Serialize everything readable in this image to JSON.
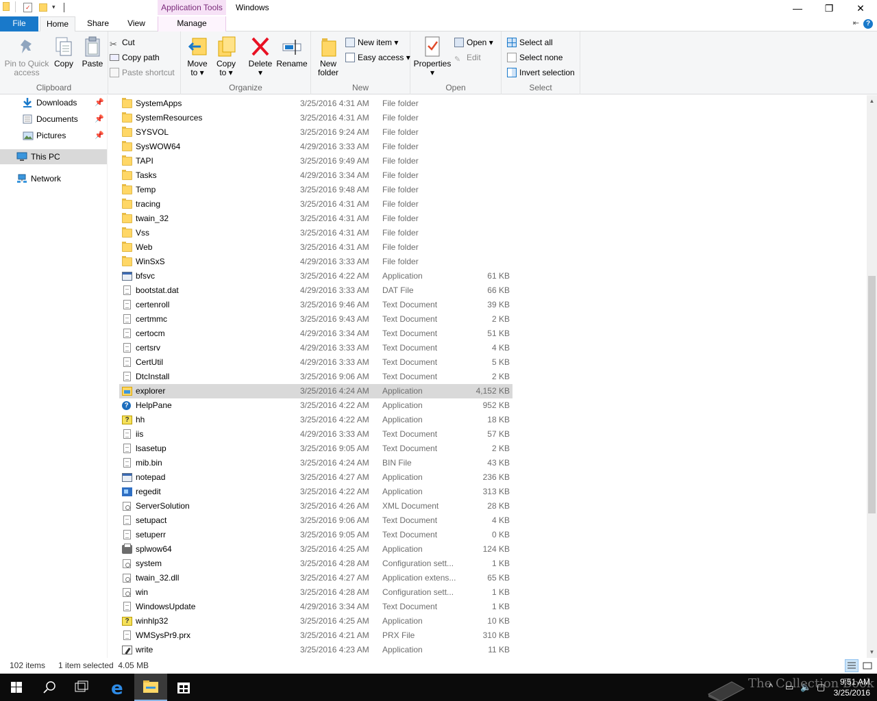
{
  "window": {
    "context_tab": "Application Tools",
    "title": "Windows",
    "minimize": "—",
    "maximize": "❐",
    "close": "✕"
  },
  "tabs": {
    "file": "File",
    "home": "Home",
    "share": "Share",
    "view": "View",
    "manage": "Manage",
    "help": "?"
  },
  "ribbon": {
    "clipboard": {
      "label": "Clipboard",
      "pin_line1": "Pin to Quick",
      "pin_line2": "access",
      "copy": "Copy",
      "paste": "Paste",
      "cut": "Cut",
      "copy_path": "Copy path",
      "paste_shortcut": "Paste shortcut"
    },
    "organize": {
      "label": "Organize",
      "move_line1": "Move",
      "move_line2": "to ▾",
      "copy_line1": "Copy",
      "copy_line2": "to ▾",
      "delete_line1": "Delete",
      "delete_line2": "▾",
      "rename": "Rename"
    },
    "new": {
      "label": "New",
      "new_folder_line1": "New",
      "new_folder_line2": "folder",
      "new_item": "New item ▾",
      "easy_access": "Easy access ▾"
    },
    "open": {
      "label": "Open",
      "properties_line1": "Properties",
      "properties_line2": "▾",
      "open": "Open ▾",
      "edit": "Edit"
    },
    "select": {
      "label": "Select",
      "select_all": "Select all",
      "select_none": "Select none",
      "invert_selection": "Invert selection"
    }
  },
  "nav": {
    "downloads": "Downloads",
    "documents": "Documents",
    "pictures": "Pictures",
    "this_pc": "This PC",
    "network": "Network",
    "pin": "📌"
  },
  "files": [
    {
      "name": "SystemApps",
      "date": "3/25/2016 4:31 AM",
      "type": "File folder",
      "size": "",
      "icon": "folder"
    },
    {
      "name": "SystemResources",
      "date": "3/25/2016 4:31 AM",
      "type": "File folder",
      "size": "",
      "icon": "folder"
    },
    {
      "name": "SYSVOL",
      "date": "3/25/2016 9:24 AM",
      "type": "File folder",
      "size": "",
      "icon": "folder"
    },
    {
      "name": "SysWOW64",
      "date": "4/29/2016 3:33 AM",
      "type": "File folder",
      "size": "",
      "icon": "folder"
    },
    {
      "name": "TAPI",
      "date": "3/25/2016 9:49 AM",
      "type": "File folder",
      "size": "",
      "icon": "folder"
    },
    {
      "name": "Tasks",
      "date": "4/29/2016 3:34 AM",
      "type": "File folder",
      "size": "",
      "icon": "folder"
    },
    {
      "name": "Temp",
      "date": "3/25/2016 9:48 AM",
      "type": "File folder",
      "size": "",
      "icon": "folder"
    },
    {
      "name": "tracing",
      "date": "3/25/2016 4:31 AM",
      "type": "File folder",
      "size": "",
      "icon": "folder"
    },
    {
      "name": "twain_32",
      "date": "3/25/2016 4:31 AM",
      "type": "File folder",
      "size": "",
      "icon": "folder"
    },
    {
      "name": "Vss",
      "date": "3/25/2016 4:31 AM",
      "type": "File folder",
      "size": "",
      "icon": "folder"
    },
    {
      "name": "Web",
      "date": "3/25/2016 4:31 AM",
      "type": "File folder",
      "size": "",
      "icon": "folder"
    },
    {
      "name": "WinSxS",
      "date": "4/29/2016 3:33 AM",
      "type": "File folder",
      "size": "",
      "icon": "folder"
    },
    {
      "name": "bfsvc",
      "date": "3/25/2016 4:22 AM",
      "type": "Application",
      "size": "61 KB",
      "icon": "app"
    },
    {
      "name": "bootstat.dat",
      "date": "4/29/2016 3:33 AM",
      "type": "DAT File",
      "size": "66 KB",
      "icon": "doc"
    },
    {
      "name": "certenroll",
      "date": "3/25/2016 9:46 AM",
      "type": "Text Document",
      "size": "39 KB",
      "icon": "doc"
    },
    {
      "name": "certmmc",
      "date": "3/25/2016 9:43 AM",
      "type": "Text Document",
      "size": "2 KB",
      "icon": "doc"
    },
    {
      "name": "certocm",
      "date": "4/29/2016 3:34 AM",
      "type": "Text Document",
      "size": "51 KB",
      "icon": "doc"
    },
    {
      "name": "certsrv",
      "date": "4/29/2016 3:33 AM",
      "type": "Text Document",
      "size": "4 KB",
      "icon": "doc"
    },
    {
      "name": "CertUtil",
      "date": "4/29/2016 3:33 AM",
      "type": "Text Document",
      "size": "5 KB",
      "icon": "doc"
    },
    {
      "name": "DtcInstall",
      "date": "3/25/2016 9:06 AM",
      "type": "Text Document",
      "size": "2 KB",
      "icon": "doc"
    },
    {
      "name": "explorer",
      "date": "3/25/2016 4:24 AM",
      "type": "Application",
      "size": "4,152 KB",
      "icon": "explorer",
      "selected": true
    },
    {
      "name": "HelpPane",
      "date": "3/25/2016 4:22 AM",
      "type": "Application",
      "size": "952 KB",
      "icon": "help"
    },
    {
      "name": "hh",
      "date": "3/25/2016 4:22 AM",
      "type": "Application",
      "size": "18 KB",
      "icon": "ques"
    },
    {
      "name": "iis",
      "date": "4/29/2016 3:33 AM",
      "type": "Text Document",
      "size": "57 KB",
      "icon": "doc"
    },
    {
      "name": "lsasetup",
      "date": "3/25/2016 9:05 AM",
      "type": "Text Document",
      "size": "2 KB",
      "icon": "doc"
    },
    {
      "name": "mib.bin",
      "date": "3/25/2016 4:24 AM",
      "type": "BIN File",
      "size": "43 KB",
      "icon": "doc"
    },
    {
      "name": "notepad",
      "date": "3/25/2016 4:27 AM",
      "type": "Application",
      "size": "236 KB",
      "icon": "app"
    },
    {
      "name": "regedit",
      "date": "3/25/2016 4:22 AM",
      "type": "Application",
      "size": "313 KB",
      "icon": "reg"
    },
    {
      "name": "ServerSolution",
      "date": "3/25/2016 4:26 AM",
      "type": "XML Document",
      "size": "28 KB",
      "icon": "cfg"
    },
    {
      "name": "setupact",
      "date": "3/25/2016 9:06 AM",
      "type": "Text Document",
      "size": "4 KB",
      "icon": "doc"
    },
    {
      "name": "setuperr",
      "date": "3/25/2016 9:05 AM",
      "type": "Text Document",
      "size": "0 KB",
      "icon": "doc"
    },
    {
      "name": "splwow64",
      "date": "3/25/2016 4:25 AM",
      "type": "Application",
      "size": "124 KB",
      "icon": "print"
    },
    {
      "name": "system",
      "date": "3/25/2016 4:28 AM",
      "type": "Configuration sett...",
      "size": "1 KB",
      "icon": "cfg"
    },
    {
      "name": "twain_32.dll",
      "date": "3/25/2016 4:27 AM",
      "type": "Application extens...",
      "size": "65 KB",
      "icon": "cfg"
    },
    {
      "name": "win",
      "date": "3/25/2016 4:28 AM",
      "type": "Configuration sett...",
      "size": "1 KB",
      "icon": "cfg"
    },
    {
      "name": "WindowsUpdate",
      "date": "4/29/2016 3:34 AM",
      "type": "Text Document",
      "size": "1 KB",
      "icon": "doc"
    },
    {
      "name": "winhlp32",
      "date": "3/25/2016 4:25 AM",
      "type": "Application",
      "size": "10 KB",
      "icon": "ques"
    },
    {
      "name": "WMSysPr9.prx",
      "date": "3/25/2016 4:21 AM",
      "type": "PRX File",
      "size": "310 KB",
      "icon": "doc"
    },
    {
      "name": "write",
      "date": "3/25/2016 4:23 AM",
      "type": "Application",
      "size": "11 KB",
      "icon": "write"
    }
  ],
  "status": {
    "item_count": "102 items",
    "selection": "1 item selected  4.05 MB"
  },
  "scroll": {
    "position_fraction": 0.56,
    "visible_fraction": 0.44
  },
  "taskbar": {
    "time": "9:51 AM",
    "date": "3/25/2016",
    "watermark": "The Collection Book"
  },
  "colors": {
    "accent": "#1979ca",
    "context_tab": "#f6e1f6",
    "selection": "#d9d9d9",
    "folder": "#ffd766"
  }
}
